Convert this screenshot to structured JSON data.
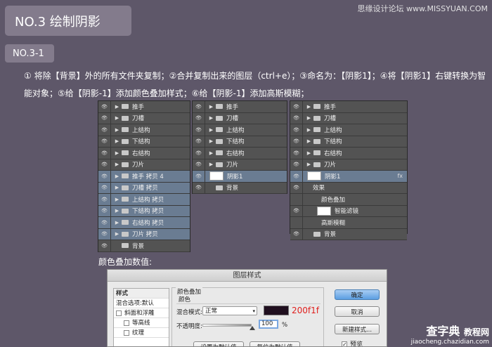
{
  "watermark_top": "思缘设计论坛 www.MISSYUAN.COM",
  "title": "NO.3 绘制阴影",
  "subtitle": "NO.3-1",
  "description": "① 将除【背景】外的所有文件夹复制；②合并复制出来的图层（ctrl+e）；③命名为：【阴影1】；④将【阴影1】右键转换为智能对象；⑤给【阴影-1】添加颜色叠加样式；⑥给【阴影-1】添加高斯模糊；",
  "panel1": [
    "推手",
    "刀槽",
    "上结构",
    "下结构",
    "右结构",
    "刀片",
    "推手 拷贝 4",
    "刀槽 拷贝",
    "上结构 拷贝",
    "下结构 拷贝",
    "右结构 拷贝",
    "刀片 拷贝",
    "背景"
  ],
  "panel2": [
    "推手",
    "刀槽",
    "上结构",
    "下结构",
    "右结构",
    "刀片",
    "阴影1",
    "背景"
  ],
  "panel3": {
    "layers": [
      "推手",
      "刀槽",
      "上结构",
      "下结构",
      "右结构",
      "刀片"
    ],
    "shadow_layer": "阴影1",
    "effects": "效果",
    "color_overlay": "颜色叠加",
    "smart_filters": "智能滤镜",
    "gaussian_blur": "高斯模糊",
    "background": "背景"
  },
  "section_label": "颜色叠加数值:",
  "dialog": {
    "title": "图层样式",
    "styles_header": "样式",
    "blend_default": "混合选项:默认",
    "bevel": "斜面和浮雕",
    "contour": "等高线",
    "texture": "纹理",
    "group_title": "颜色叠加",
    "color_label": "颜色",
    "blend_mode_label": "混合模式:",
    "blend_mode_value": "正常",
    "opacity_label": "不透明度:",
    "opacity_value": "100",
    "opacity_unit": "%",
    "color_hex": "200f1f",
    "swatch_color": "#200f1f",
    "hex_color": "#e0201e",
    "ok": "确定",
    "cancel": "取消",
    "new_style": "新建样式...",
    "preview": "预览",
    "set_default": "设置为默认值",
    "reset_default": "复位为默认值"
  },
  "watermark_bottom": {
    "brand": "查字典",
    "sub": "教程网",
    "url": "jiaocheng.chazidian.com"
  }
}
